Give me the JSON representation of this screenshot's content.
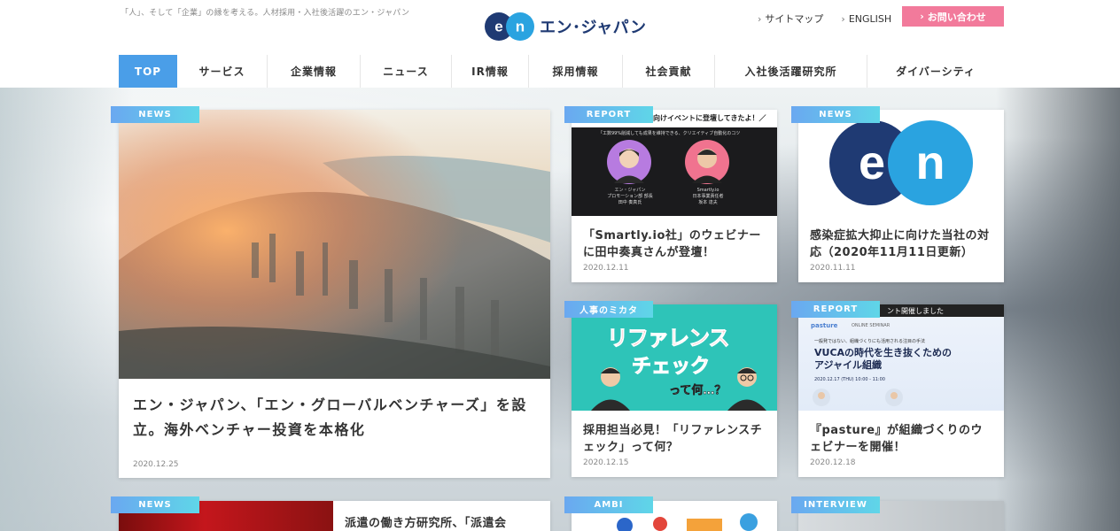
{
  "header": {
    "tagline": "「人」、そして「企業」の縁を考える。人材採用・入社後活躍のエン・ジャパン",
    "logo_mark": "en",
    "logo_text": "エン･ジャパン",
    "util_links": [
      {
        "label": "サイトマップ"
      },
      {
        "label": "ENGLISH"
      }
    ],
    "contact_label": "お問い合わせ",
    "colors": {
      "accent": "#4a9ee8",
      "contact": "#f27a9b",
      "logo_navy": "#1f3a73",
      "logo_blue": "#2aa3e0"
    }
  },
  "nav": {
    "items": [
      {
        "label": "TOP"
      },
      {
        "label": "サービス"
      },
      {
        "label": "企業情報"
      },
      {
        "label": "ニュース"
      },
      {
        "label": "IR情報"
      },
      {
        "label": "採用情報"
      },
      {
        "label": "社会貢献"
      },
      {
        "label": "入社後活躍研究所"
      },
      {
        "label": "ダイバーシティ"
      }
    ]
  },
  "cards": {
    "main": {
      "tag": "NEWS",
      "title": "エン・ジャパン、「エン・グローバルベンチャーズ」を設立。海外ベンチャー投資を本格化",
      "date": "2020.12.25"
    },
    "smartly": {
      "tag": "REPORT",
      "banner": "向けイベントに登壇してきたよ！／",
      "subtitle": "「工数99%削減しても成果を維持できる、クリエイティブ自動化のコツ",
      "left_person": "エン・ジャパン\nプロモーション部 部長\n田中 奏真氏",
      "right_person": "Smartly.io\n日本事業責任者\n坂本 達夫",
      "title": "「Smartly.io社」のウェビナーに田中奏真さんが登壇！",
      "date": "2020.12.11"
    },
    "covid": {
      "tag": "NEWS",
      "logo": "en",
      "title": "感染症拡大抑止に向けた当社の対応（2020年11月11日更新）",
      "date": "2020.11.11"
    },
    "reference": {
      "tag": "人事のミカタ",
      "line1": "リファレンス",
      "line2": "チェック",
      "line3": "って何…？",
      "title": "採用担当必見！「リファレンスチェック」って何？",
      "date": "2020.12.15"
    },
    "pasture": {
      "tag": "REPORT",
      "banner": "ント開催しました",
      "brand": "pasture",
      "seminar": "ONLINE SEMINAR",
      "lead": "一般発ではない、組織づくりにも活用される注目の手法",
      "headline": "VUCAの時代を生き抜くための\nアジャイル組織",
      "when": "2020.12.17 (THU) 10:00 - 11:00",
      "title": "『pasture』が組織づくりのウェビナーを開催！",
      "date": "2020.12.18"
    },
    "bottom_news": {
      "tag": "NEWS",
      "title": "派遣の働き方研究所、「派遣会"
    },
    "bottom_ambi": {
      "tag": "AMBI"
    },
    "bottom_interview": {
      "tag": "INTERVIEW"
    }
  }
}
